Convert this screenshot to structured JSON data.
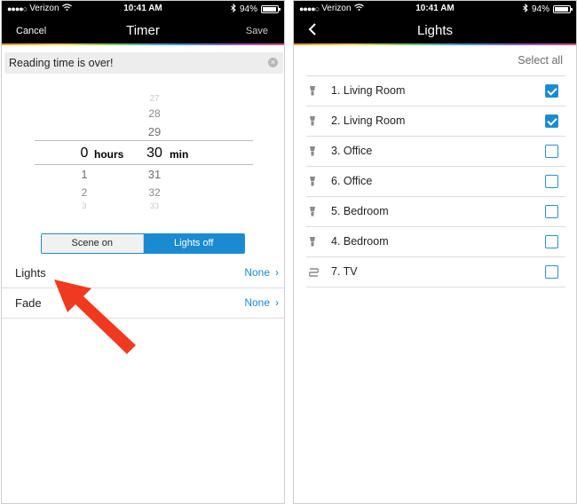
{
  "status_bar": {
    "carrier": "Verizon",
    "time": "10:41 AM",
    "battery": "94%",
    "battery_level": 0.94
  },
  "timer_screen": {
    "cancel_label": "Cancel",
    "title": "Timer",
    "save_label": "Save",
    "name_value": "Reading time is over!",
    "picker": {
      "hours_above": [
        "",
        ""
      ],
      "minutes_above": [
        "27",
        "28",
        "29"
      ],
      "hours_selected": "0",
      "hours_unit": "hours",
      "minutes_selected": "30",
      "minutes_unit": "min",
      "hours_below": [
        "1",
        "2",
        "3"
      ],
      "minutes_below": [
        "31",
        "32",
        "33"
      ]
    },
    "segment": {
      "left": "Scene on",
      "right": "Lights off",
      "selected": "right"
    },
    "rows": [
      {
        "label": "Lights",
        "value": "None"
      },
      {
        "label": "Fade",
        "value": "None"
      }
    ],
    "accent_color": "#1a8bd1",
    "arrow_color": "#f03a1f"
  },
  "lights_screen": {
    "title": "Lights",
    "select_all_label": "Select all",
    "items": [
      {
        "name": "1. Living Room",
        "icon": "bulb-icon",
        "checked": true
      },
      {
        "name": "2. Living Room",
        "icon": "bulb-icon",
        "checked": true
      },
      {
        "name": "3. Office",
        "icon": "bulb-icon",
        "checked": false
      },
      {
        "name": "6. Office",
        "icon": "bulb-icon",
        "checked": false
      },
      {
        "name": "5. Bedroom",
        "icon": "bulb-icon",
        "checked": false
      },
      {
        "name": "4. Bedroom",
        "icon": "bulb-icon",
        "checked": false
      },
      {
        "name": "7. TV",
        "icon": "lightstrip-icon",
        "checked": false
      }
    ]
  }
}
